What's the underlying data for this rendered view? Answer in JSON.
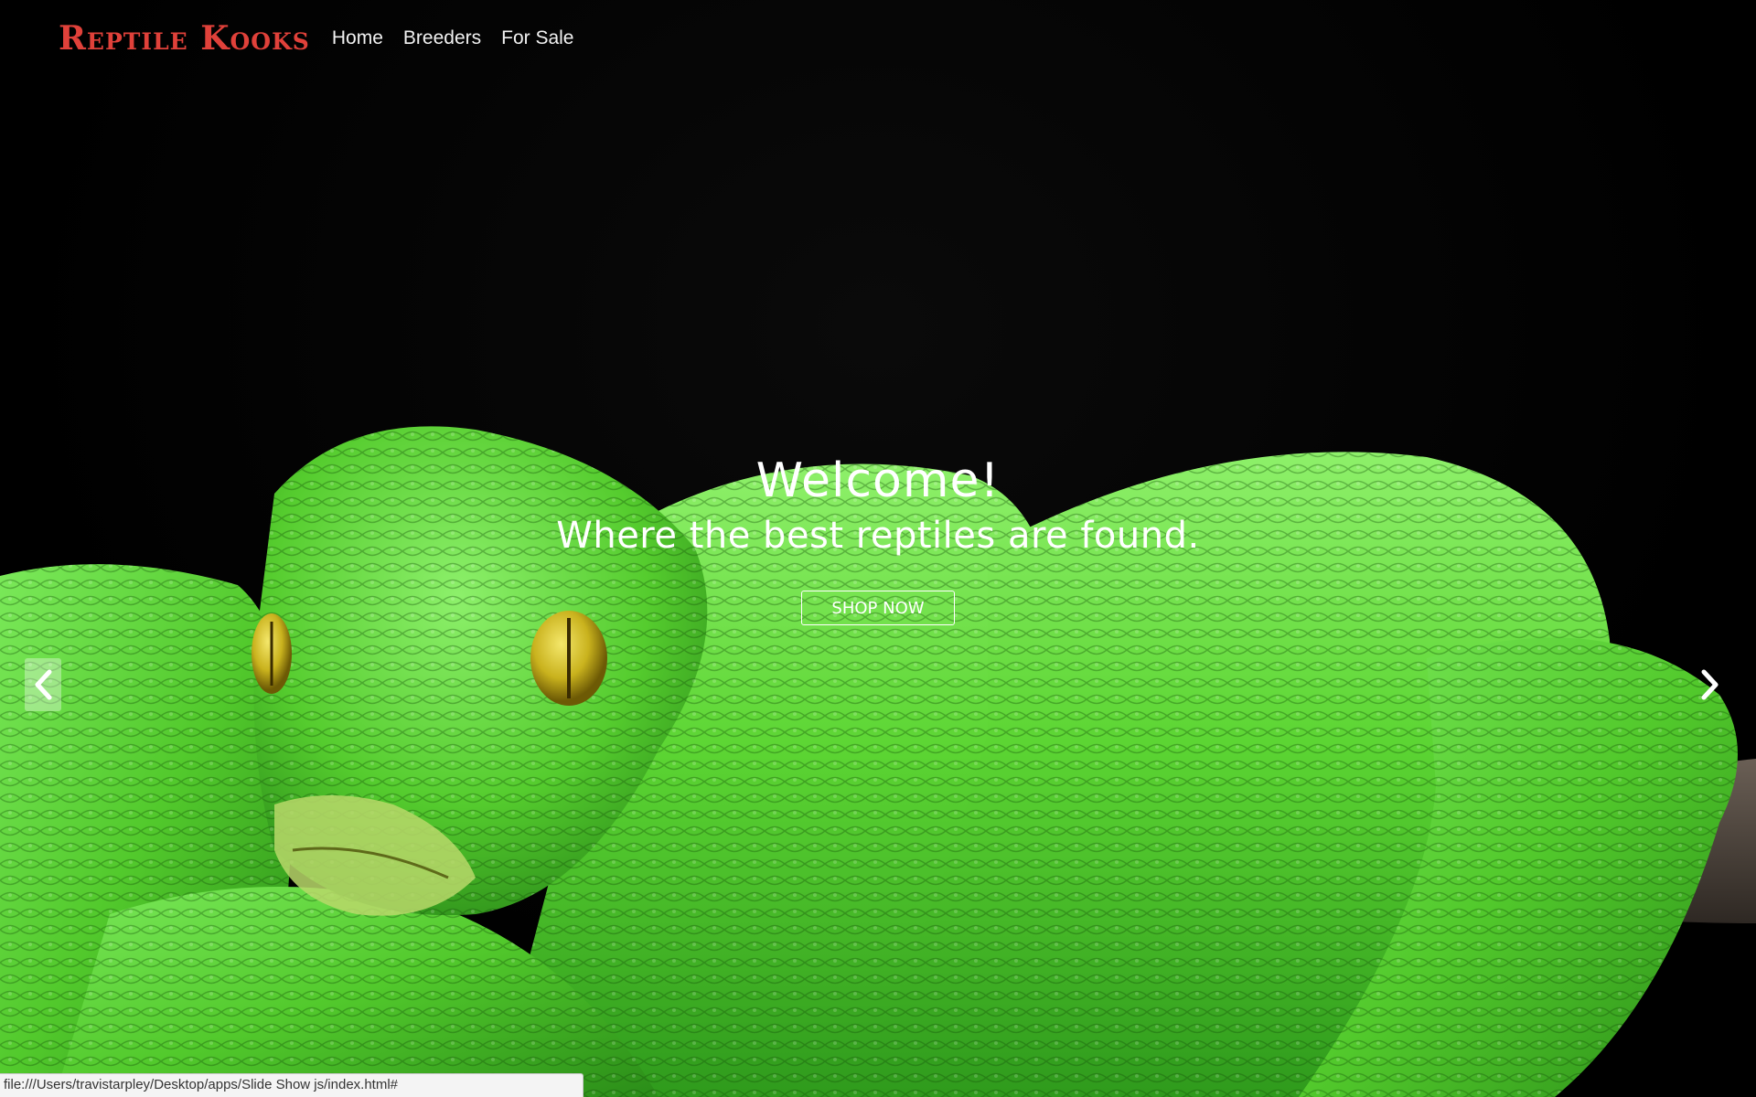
{
  "brand": {
    "name": "Reptile Kooks",
    "color": "#e0413a"
  },
  "nav": {
    "items": [
      {
        "label": "Home"
      },
      {
        "label": "Breeders"
      },
      {
        "label": "For Sale"
      }
    ]
  },
  "hero": {
    "image": "green-tree-python",
    "title": "Welcome!",
    "subtitle": "Where the best reptiles are found.",
    "cta_label": "SHOP NOW",
    "prev_icon": "chevron-left-icon",
    "next_icon": "chevron-right-icon"
  },
  "status_bar": {
    "url": "file:///Users/travistarpley/Desktop/apps/Slide Show js/index.html#"
  },
  "colors": {
    "background": "#000000",
    "snake_green": "#5fd43a",
    "eye": "#c9b21d"
  }
}
